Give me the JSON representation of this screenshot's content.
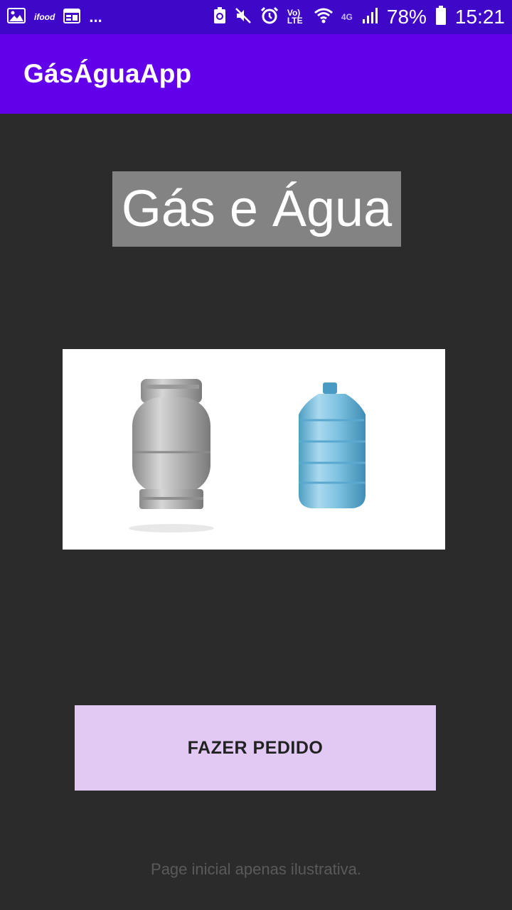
{
  "status_bar": {
    "left_icons": [
      "image-icon",
      "ifood-icon",
      "calendar-icon",
      "more-icon"
    ],
    "ifood_text": "ifood",
    "more_text": "...",
    "right_icons": [
      "battery-saver-icon",
      "mute-icon",
      "alarm-icon",
      "volte-icon",
      "wifi-icon",
      "4g-icon",
      "signal-icon",
      "battery-icon"
    ],
    "volte_text": "Vo) LTE",
    "network_text": "4G",
    "battery_percent": "78%",
    "time": "15:21"
  },
  "app_bar": {
    "title": "GásÁguaApp"
  },
  "main": {
    "heading": "Gás e Água",
    "image_items": [
      "gas-cylinder",
      "water-jug"
    ],
    "order_button_label": "FAZER PEDIDO",
    "footer_note": "Page inicial apenas ilustrativa."
  },
  "colors": {
    "status_bar": "#3f07c7",
    "app_bar": "#6200ea",
    "background": "#2b2b2b",
    "heading_bg": "#838383",
    "button_bg": "#e1c9f3"
  }
}
